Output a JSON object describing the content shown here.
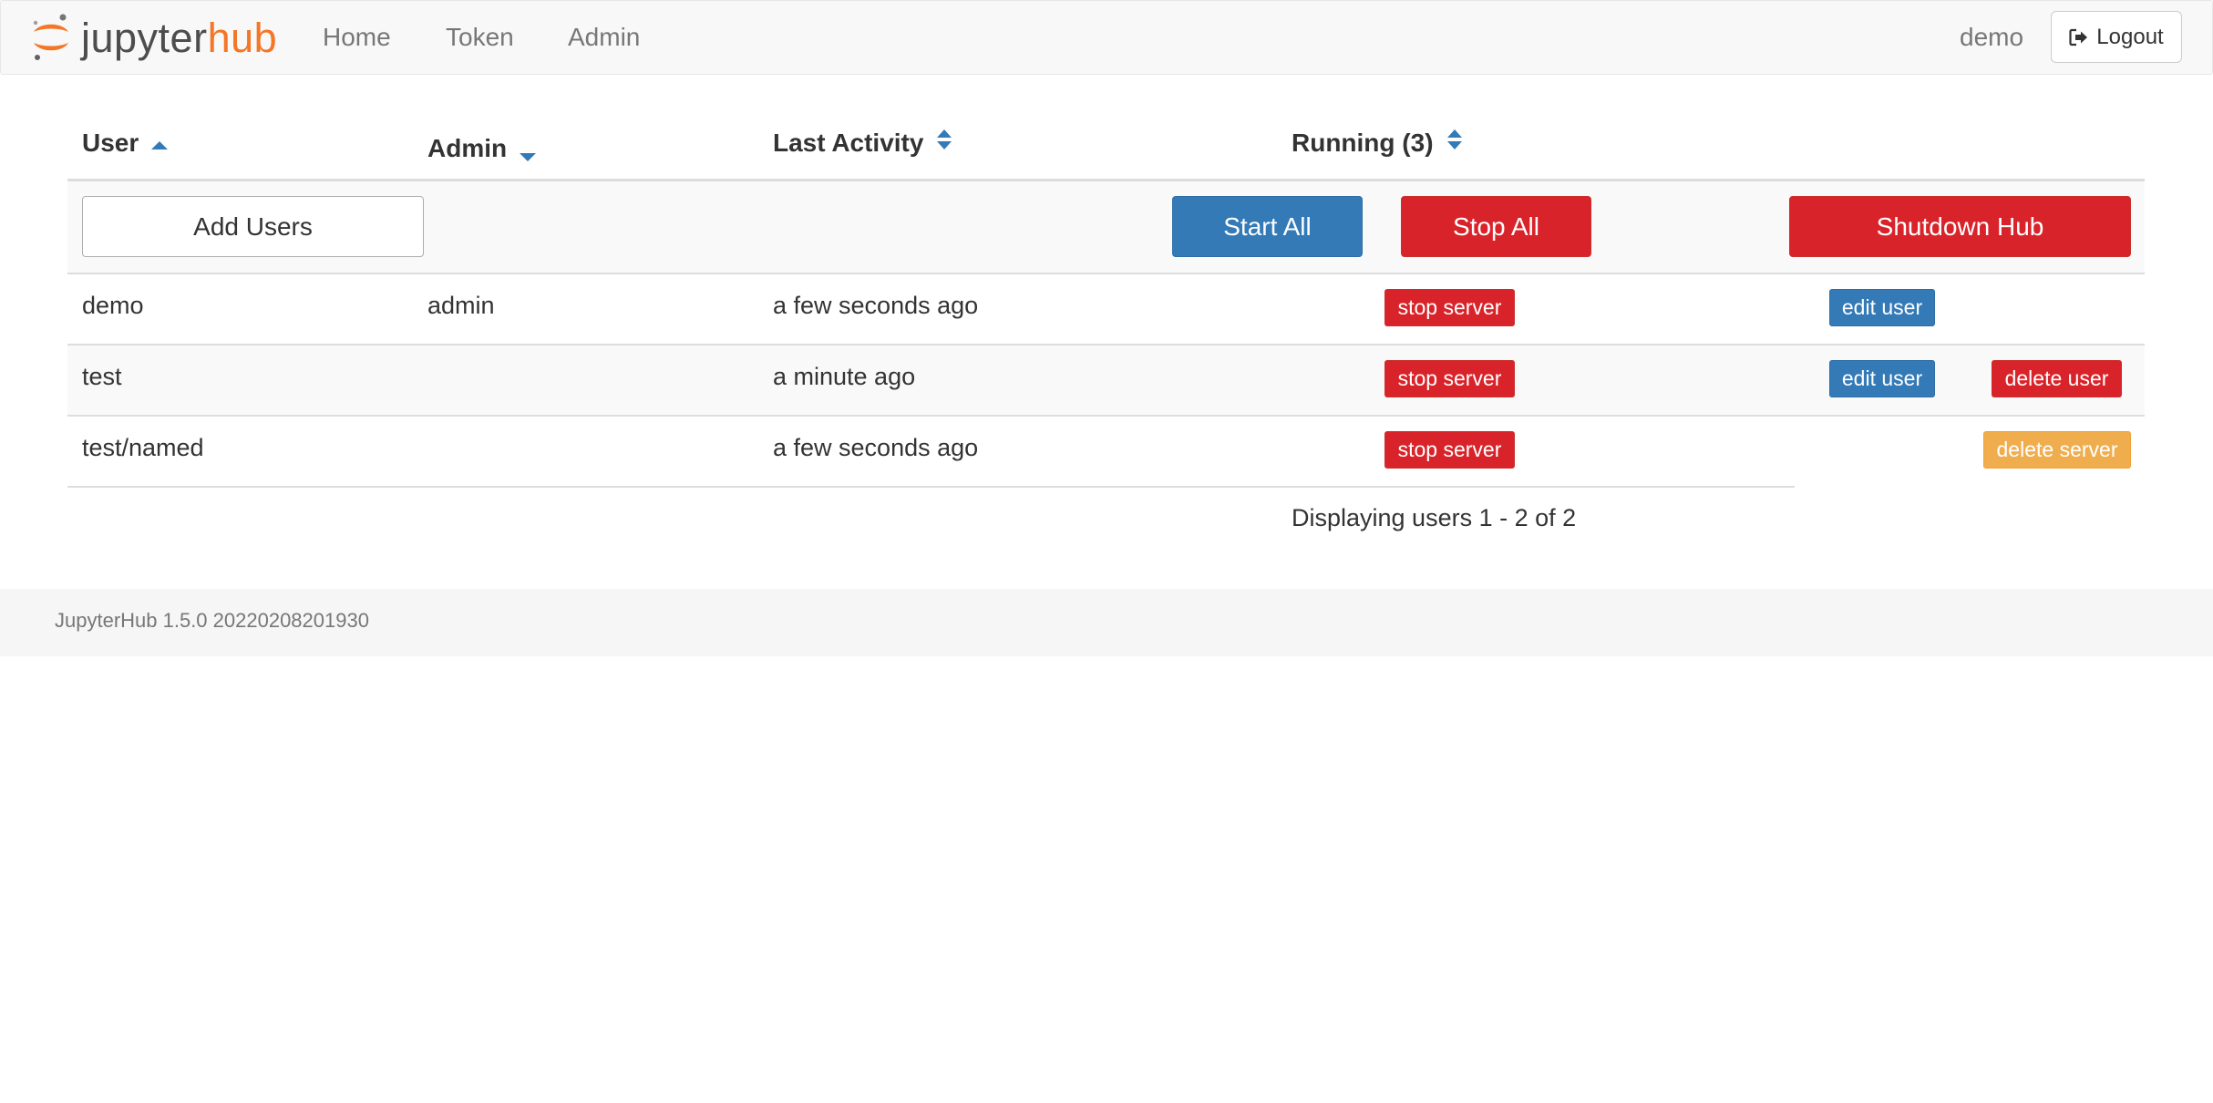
{
  "navbar": {
    "logo_part1": "jupyter",
    "logo_part2": "hub",
    "links": [
      "Home",
      "Token",
      "Admin"
    ],
    "user": "demo",
    "logout_label": "Logout"
  },
  "table": {
    "headers": {
      "user": "User",
      "admin": "Admin",
      "last_activity": "Last Activity",
      "running": "Running (3)"
    },
    "actions": {
      "add_users": "Add Users",
      "start_all": "Start All",
      "stop_all": "Stop All",
      "shutdown_hub": "Shutdown Hub"
    },
    "rows": [
      {
        "user": "demo",
        "admin": "admin",
        "last_activity": "a few seconds ago",
        "server_action": "stop server",
        "edit": "edit user",
        "delete": ""
      },
      {
        "user": "test",
        "admin": "",
        "last_activity": "a minute ago",
        "server_action": "stop server",
        "edit": "edit user",
        "delete": "delete user"
      },
      {
        "user": "test/named",
        "admin": "",
        "last_activity": "a few seconds ago",
        "server_action": "stop server",
        "edit": "",
        "delete": "delete server"
      }
    ],
    "pagination": "Displaying users 1 - 2 of 2"
  },
  "footer": {
    "version": "JupyterHub 1.5.0 20220208201930"
  },
  "colors": {
    "brand_orange": "#f37726",
    "primary": "#337ab7",
    "danger": "#d9232a",
    "warning": "#f0ad4e"
  }
}
